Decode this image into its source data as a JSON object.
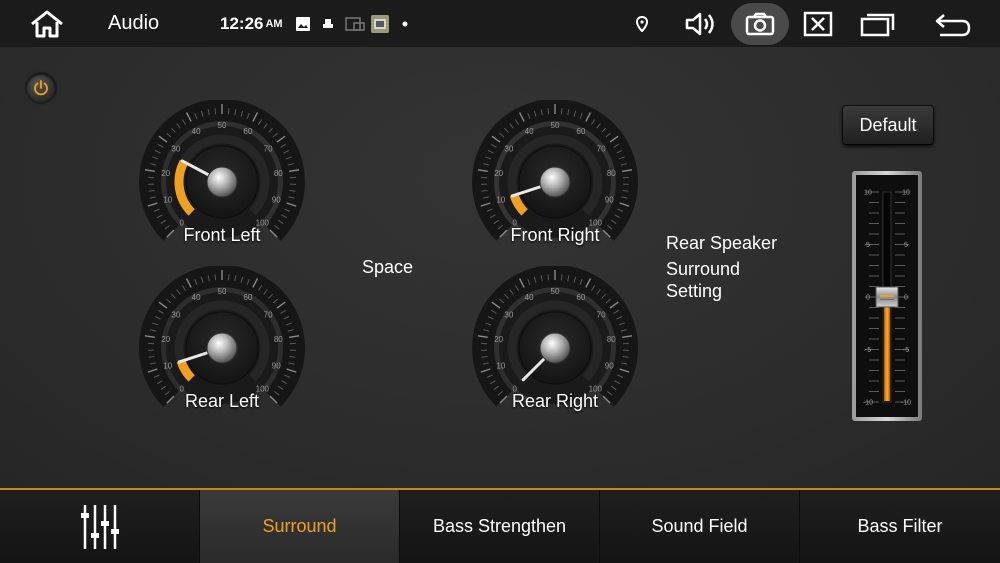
{
  "statusbar": {
    "title": "Audio",
    "time": "12:26",
    "ampm": "AM"
  },
  "knobs": [
    {
      "id": "front-left",
      "label": "Front Left",
      "value": 27
    },
    {
      "id": "front-right",
      "label": "Front Right",
      "value": 10
    },
    {
      "id": "rear-left",
      "label": "Rear Left",
      "value": 10
    },
    {
      "id": "rear-right",
      "label": "Rear Right",
      "value": 0
    }
  ],
  "knob_scale": [
    "0",
    "10",
    "20",
    "30",
    "40",
    "50",
    "60",
    "70",
    "80",
    "90",
    "100"
  ],
  "space_label": "Space",
  "rear_speaker": {
    "line1": "Rear Speaker",
    "line2": "Surround",
    "line3": "Setting"
  },
  "default_label": "Default",
  "slider": {
    "value": 0,
    "min": -10,
    "max": 10,
    "tick_labels": [
      "10",
      "5",
      "0",
      "-5",
      "-10"
    ]
  },
  "tabs": [
    {
      "label": "Surround",
      "active": true
    },
    {
      "label": "Bass Strengthen",
      "active": false
    },
    {
      "label": "Sound Field",
      "active": false
    },
    {
      "label": "Bass Filter",
      "active": false
    }
  ],
  "colors": {
    "accent": "#f0a020",
    "statusbar": "#1b1b1b",
    "background": "#2d2d2d"
  }
}
